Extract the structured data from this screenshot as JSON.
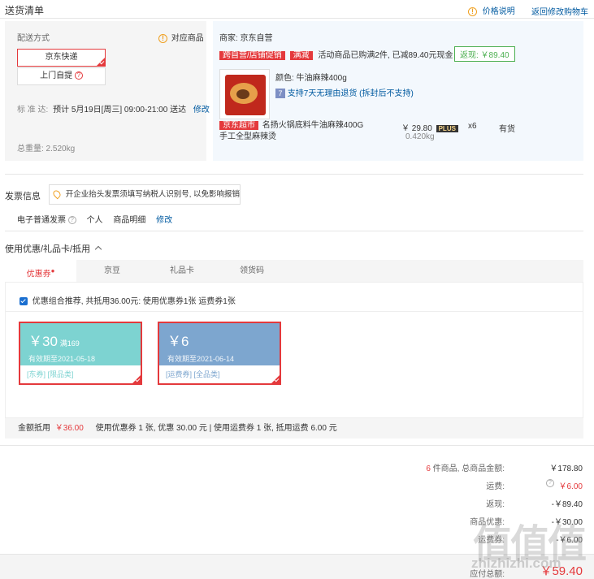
{
  "header": {
    "title": "送货清单",
    "price_desc": "价格说明",
    "back_cart": "返回修改购物车"
  },
  "delivery": {
    "label": "配送方式",
    "match_goods": "对应商品",
    "options": [
      "京东快递",
      "上门自提"
    ],
    "standard_label": "标 准 达:",
    "standard_value": "预计 5月19日[周三] 09:00-21:00 送达",
    "modify": "修改",
    "total_weight": "总重量: 2.520kg"
  },
  "merchant": {
    "label": "商家: 京东自营",
    "promo_tags": [
      "跨自营/店铺促销",
      "满减"
    ],
    "promo_text": "活动商品已购满2件, 已减89.40元现金",
    "cashback": "返现: ￥89.40",
    "item": {
      "color": "颜色: 牛油麻辣400g",
      "return_policy": "支持7天无理由退货 (拆封后不支持)",
      "store_tag": "京东超市",
      "name": "名扬火锅底料牛油麻辣400G 手工全型麻辣烫",
      "price": "￥ 29.80",
      "plus": "PLUS",
      "qty": "x6",
      "stock": "有货",
      "weight": "0.420kg"
    }
  },
  "invoice": {
    "title": "发票信息",
    "notice": "开企业抬头发票须填写纳税人识别号, 以免影响报销",
    "type": "电子普通发票",
    "person": "个人",
    "detail": "商品明细",
    "modify": "修改"
  },
  "discount": {
    "title": "使用优惠/礼品卡/抵用",
    "tabs": [
      "优惠券",
      "京豆",
      "礼品卡",
      "领货码"
    ],
    "recommend": "优惠组合推荐, 共抵用36.00元: 使用优惠券1张 运费券1张",
    "coupons": [
      {
        "amount": "￥30",
        "cond": "满169",
        "expire": "有效期至2021-05-18",
        "tags": "[东券]  [限品类]",
        "color": "#7dd3d1"
      },
      {
        "amount": "￥6",
        "cond": "",
        "expire": "有效期至2021-06-14",
        "tags": "[运费券]  [全品类]",
        "color": "#7da6cf"
      }
    ],
    "summary_label": "金额抵用",
    "summary_amount": "￥36.00",
    "summary_text": "使用优惠券 1 张, 优惠 30.00 元  | 使用运费券 1 张, 抵用运费 6.00 元"
  },
  "totals": {
    "count_prefix": "6",
    "count_label": "件商品, 总商品金额:",
    "goods_amount": "￥178.80",
    "freight_label": "运费:",
    "freight": "￥6.00",
    "cashback_label": "返现:",
    "cashback": "-￥89.40",
    "coupon_label": "商品优惠:",
    "coupon": "-￥30.00",
    "freight_coupon_label": "运费券:",
    "freight_coupon": "-￥6.00",
    "pay_label": "应付总额:",
    "pay": "￥59.40"
  },
  "watermark": "zhizhizhi.com"
}
